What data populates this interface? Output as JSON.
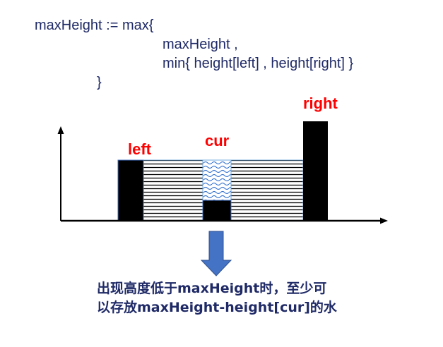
{
  "formula": {
    "line1": "maxHeight := max{",
    "line2": "maxHeight ,",
    "line3": "min{ height[left] , height[right] }",
    "line4": "}"
  },
  "labels": {
    "left": "left",
    "cur": "cur",
    "right": "right"
  },
  "caption": {
    "line1": "出现高度低于maxHeight时，至少可",
    "line2": "以存放maxHeight-height[cur]的水"
  },
  "colors": {
    "text": "#1f2a66",
    "label": "#ff0000",
    "bar": "#000000",
    "water_pattern": "#2f6fd0",
    "arrow": "#4472c4"
  },
  "figure": {
    "bars": [
      {
        "name": "left-bar",
        "height": 2
      },
      {
        "name": "cur-bar",
        "height": 1
      },
      {
        "name": "right-bar",
        "height": 3
      }
    ],
    "water_level": 2
  }
}
